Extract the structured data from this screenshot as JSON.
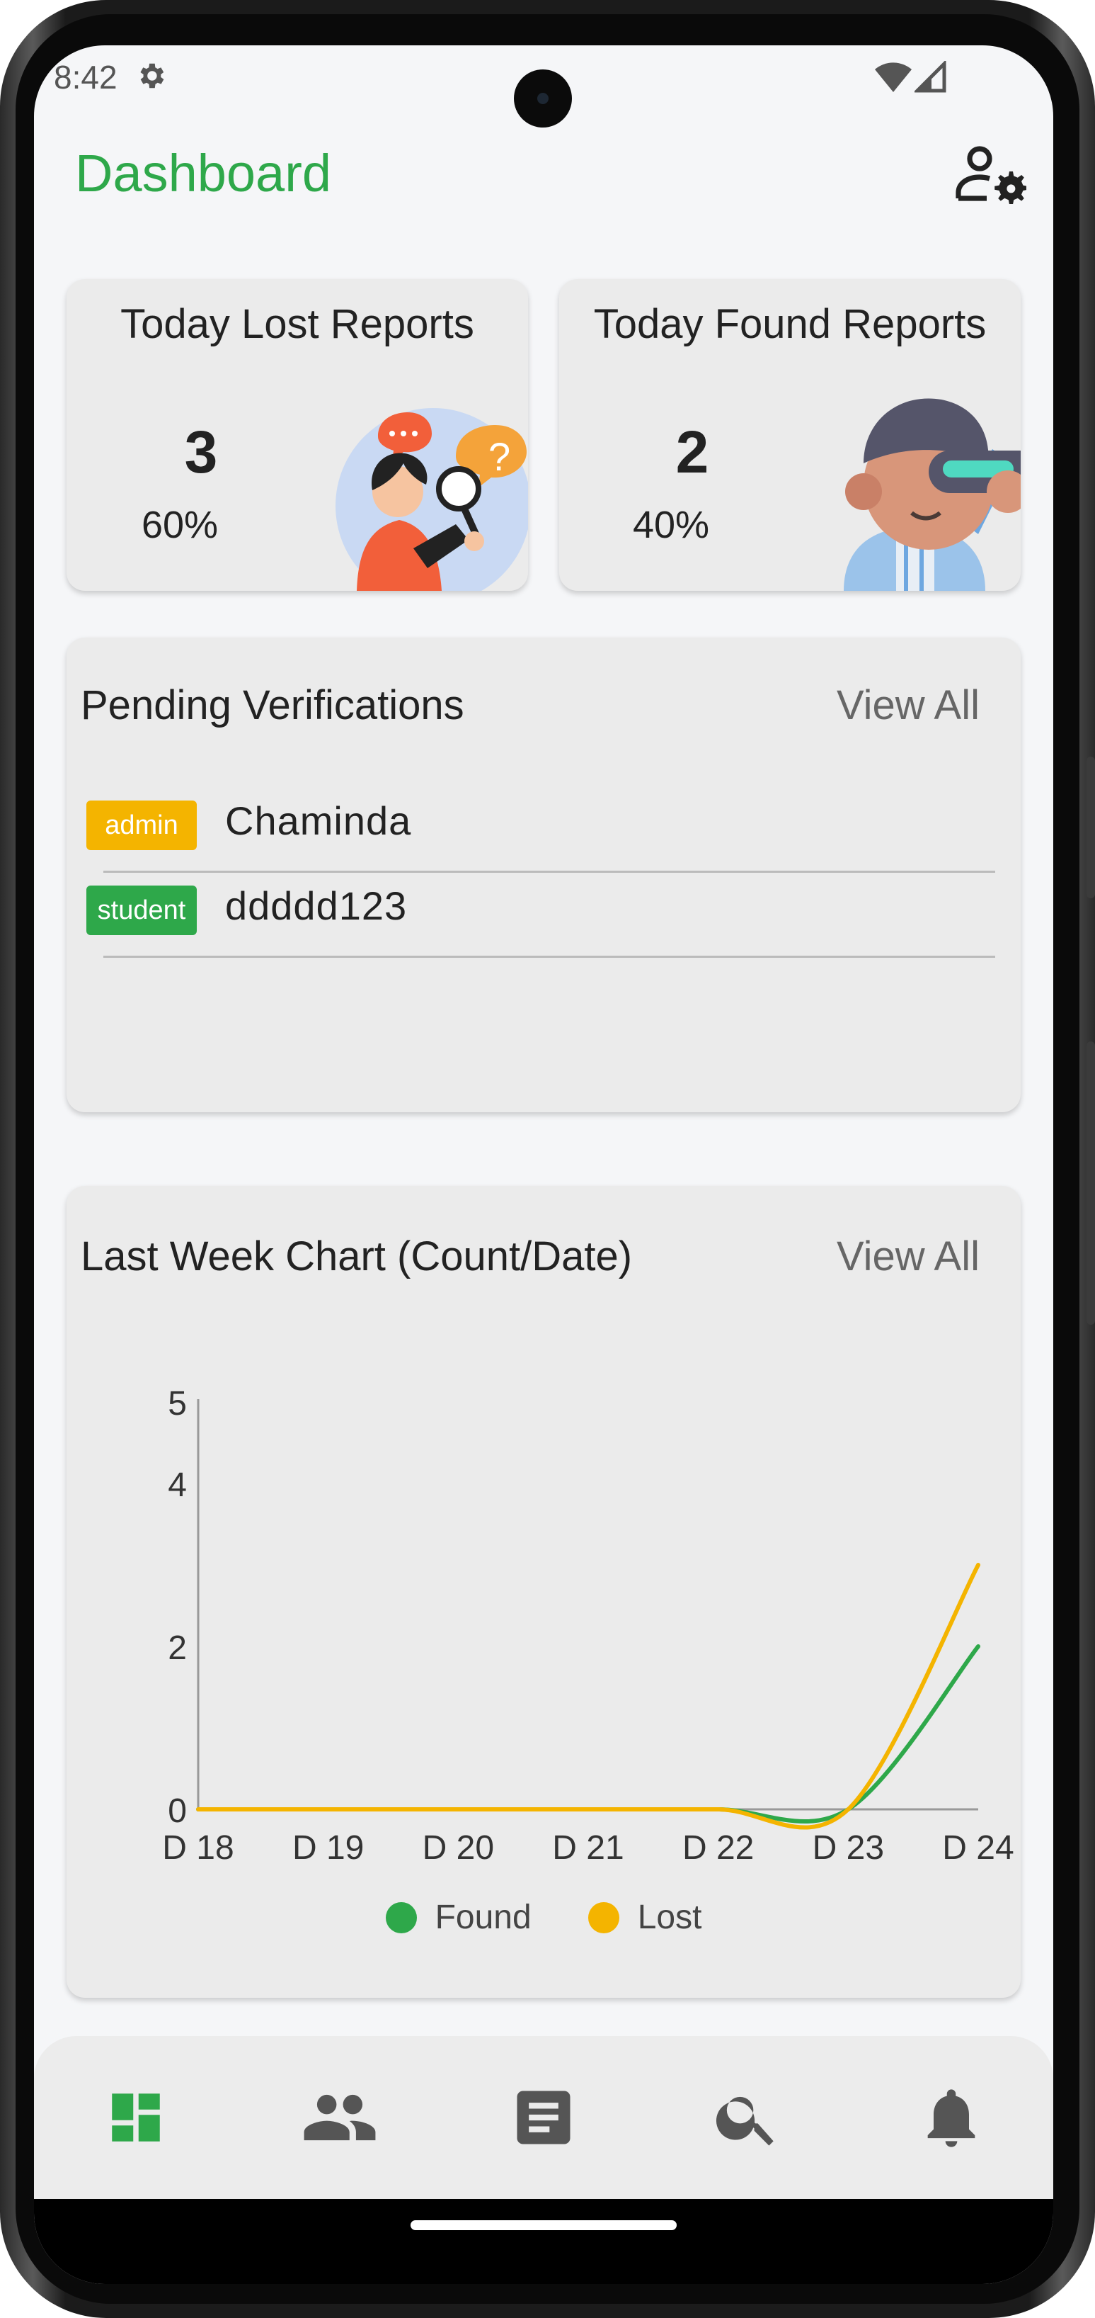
{
  "status_bar": {
    "time": "8:42"
  },
  "header": {
    "title": "Dashboard"
  },
  "stats": {
    "lost": {
      "title": "Today Lost Reports",
      "count": "3",
      "percent": "60%"
    },
    "found": {
      "title": "Today Found Reports",
      "count": "2",
      "percent": "40%"
    }
  },
  "pending": {
    "title": "Pending Verifications",
    "view_all": "View All",
    "rows": [
      {
        "role": "admin",
        "name": "Chaminda"
      },
      {
        "role": "student",
        "name": "ddddd123"
      }
    ]
  },
  "chart_section": {
    "title": "Last Week Chart (Count/Date)",
    "view_all": "View All"
  },
  "chart_data": {
    "type": "line",
    "categories": [
      "D 18",
      "D 19",
      "D 20",
      "D 21",
      "D 22",
      "D 23",
      "D 24"
    ],
    "series": [
      {
        "name": "Found",
        "color": "#2ea84a",
        "values": [
          0,
          0,
          0,
          0,
          0,
          0,
          2
        ]
      },
      {
        "name": "Lost",
        "color": "#f4b400",
        "values": [
          0,
          0,
          0,
          0,
          0,
          0,
          3
        ]
      }
    ],
    "y_ticks": [
      "0",
      "2",
      "4",
      "5"
    ],
    "ylim": [
      0,
      5
    ],
    "grid": false,
    "legend": "bottom-center"
  },
  "bottom_nav": {
    "items": [
      {
        "icon": "dashboard-icon",
        "active": true
      },
      {
        "icon": "people-icon",
        "active": false
      },
      {
        "icon": "reports-icon",
        "active": false
      },
      {
        "icon": "search-icon",
        "active": false
      },
      {
        "icon": "bell-icon",
        "active": false
      }
    ]
  },
  "colors": {
    "accent": "#2ea84a",
    "admin_badge": "#f4b400",
    "student_badge": "#2ea84a",
    "inactive_icon": "#555555"
  }
}
